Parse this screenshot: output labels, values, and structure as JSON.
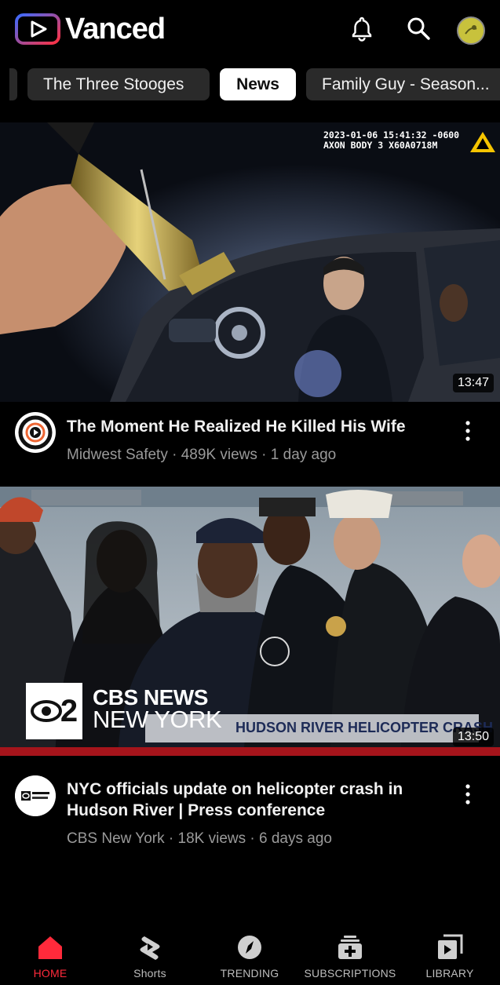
{
  "app": {
    "name": "Vanced",
    "accent": "#ff2a3b"
  },
  "header": {
    "notifications_icon": "bell-icon",
    "search_icon": "search-icon",
    "avatar_icon": "avatar-icon"
  },
  "chips": [
    {
      "label": "The Three Stooges"
    },
    {
      "label": "News",
      "selected": true
    },
    {
      "label": "Family Guy - Season..."
    }
  ],
  "videos": [
    {
      "title": "The Moment He Realized He Killed His Wife",
      "channel": "Midwest Safety",
      "views": "489K views",
      "age": "1 day ago",
      "duration": "13:47",
      "overlay_timestamp": "2023-01-06 15:41:32 -0600",
      "overlay_device": "AXON BODY 3 X60A0718M"
    },
    {
      "title": "NYC officials update on helicopter crash in Hudson River | Press conference",
      "channel": "CBS New York",
      "views": "18K views",
      "age": "6 days ago",
      "duration": "13:50",
      "overlay_brand_num": "2",
      "overlay_brand_top": "CBS NEWS",
      "overlay_brand_bottom": "NEW YORK",
      "overlay_banner": "HUDSON RIVER HELICOPTER CRASH"
    }
  ],
  "bottom_nav": [
    {
      "label": "HOME",
      "icon": "home-icon",
      "active": true
    },
    {
      "label": "Shorts",
      "icon": "shorts-icon"
    },
    {
      "label": "TRENDING",
      "icon": "trending-icon"
    },
    {
      "label": "SUBSCRIPTIONS",
      "icon": "subscriptions-icon"
    },
    {
      "label": "LIBRARY",
      "icon": "library-icon"
    }
  ]
}
